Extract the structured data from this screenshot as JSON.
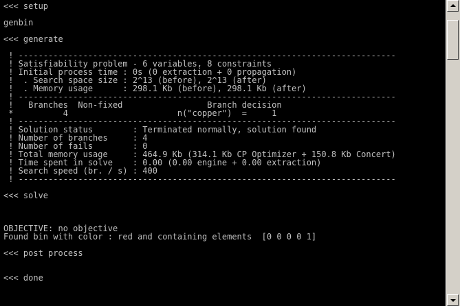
{
  "console": {
    "lines": [
      "<<< setup",
      "",
      "genbin",
      "",
      "<<< generate",
      "",
      " ! ----------------------------------------------------------------------------",
      " ! Satisfiability problem - 6 variables, 8 constraints",
      " ! Initial process time : 0s (0 extraction + 0 propagation)",
      " !  . Search space size : 2^13 (before), 2^13 (after)",
      " !  . Memory usage      : 298.1 Kb (before), 298.1 Kb (after)",
      " ! ----------------------------------------------------------------------------",
      " !   Branches  Non-fixed                 Branch decision",
      " *          4                      n(\"copper\")  =     1",
      " ! ----------------------------------------------------------------------------",
      " ! Solution status        : Terminated normally, solution found",
      " ! Number of branches     : 4",
      " ! Number of fails        : 0",
      " ! Total memory usage     : 464.9 Kb (314.1 Kb CP Optimizer + 150.8 Kb Concert)",
      " ! Time spent in solve    : 0.00 (0.00 engine + 0.00 extraction)",
      " ! Search speed (br. / s) : 400",
      " ! ----------------------------------------------------------------------------",
      "",
      "<<< solve",
      "",
      "",
      "",
      "OBJECTIVE: no objective",
      "Found bin with color : red and containing elements  [0 0 0 0 1]",
      "",
      "<<< post process",
      "",
      "",
      "<<< done"
    ]
  },
  "scrollbar": {
    "up_icon": "arrow-up-icon",
    "down_icon": "arrow-down-icon"
  }
}
